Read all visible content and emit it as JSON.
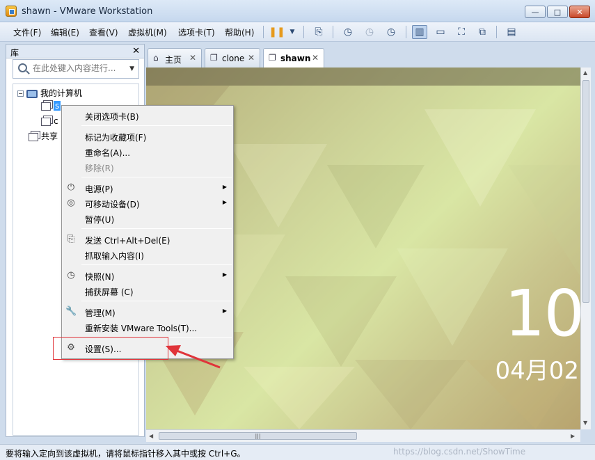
{
  "window": {
    "title": "shawn - VMware Workstation",
    "min": "—",
    "max": "□",
    "close": "✕"
  },
  "menu": [
    "文件(F)",
    "编辑(E)",
    "查看(V)",
    "虚拟机(M)",
    "选项卡(T)",
    "帮助(H)"
  ],
  "library": {
    "title": "库",
    "close": "✕",
    "search_placeholder": "在此处键入内容进行...",
    "tree": {
      "root": "我的计算机",
      "vm1": "s",
      "vm2": "c",
      "shared": "共享"
    }
  },
  "tabs": [
    {
      "label": "主页",
      "icon": "home-icon",
      "active": false
    },
    {
      "label": "clone",
      "icon": "vm-icon",
      "active": false
    },
    {
      "label": "shawn",
      "icon": "vm-icon",
      "active": true
    }
  ],
  "vm_screen": {
    "clock": "10",
    "date": "04月02"
  },
  "context_menu": {
    "close_tab": "关闭选项卡(B)",
    "bookmark": "标记为收藏项(F)",
    "rename": "重命名(A)...",
    "remove": "移除(R)",
    "power": "电源(P)",
    "removable": "可移动设备(D)",
    "pause": "暂停(U)",
    "send_cad": "发送 Ctrl+Alt+Del(E)",
    "grab_input": "抓取输入内容(I)",
    "snapshot": "快照(N)",
    "capture": "捕获屏幕 (C)",
    "manage": "管理(M)",
    "reinstall": "重新安装 VMware Tools(T)...",
    "settings": "设置(S)..."
  },
  "status": {
    "text": "要将输入定向到该虚拟机，请将鼠标指针移入其中或按 Ctrl+G。",
    "watermark": "https://blog.csdn.net/ShowTime"
  },
  "colors": {
    "highlight": "#e0343a",
    "selection": "#3399ff"
  }
}
